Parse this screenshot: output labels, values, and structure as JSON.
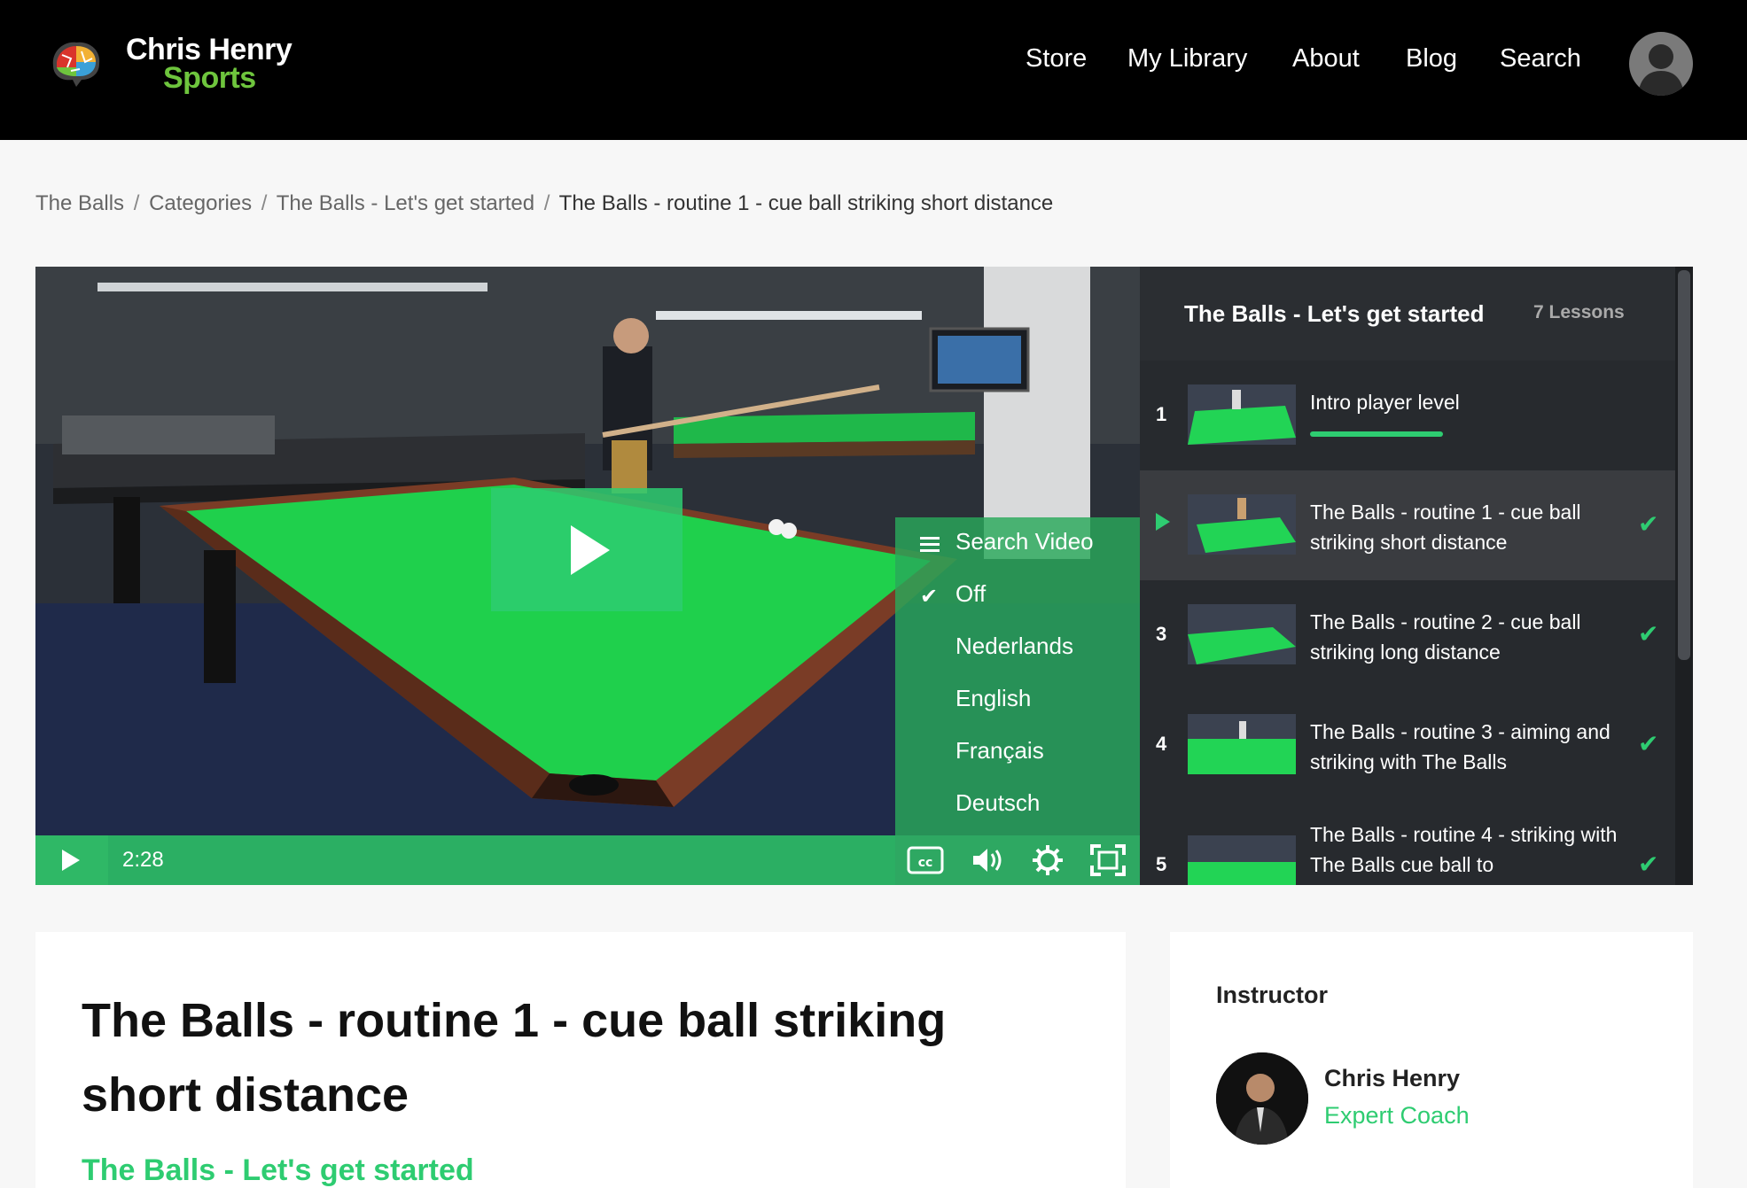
{
  "header": {
    "logo_line1": "Chris Henry",
    "logo_line2": "Sports",
    "nav": [
      "Store",
      "My Library",
      "About",
      "Blog",
      "Search"
    ]
  },
  "breadcrumb": {
    "items": [
      "The Balls",
      "Categories",
      "The Balls - Let's get started"
    ],
    "current": "The Balls - routine 1 - cue ball striking short distance",
    "separator": "/"
  },
  "player": {
    "time": "2:28",
    "captions_menu": {
      "header": "Search Video",
      "options": [
        "Off",
        "Nederlands",
        "English",
        "Français",
        "Deutsch"
      ],
      "selected": "Off"
    },
    "control_icons": [
      "play-icon",
      "closed-captions-icon",
      "volume-icon",
      "settings-icon",
      "fullscreen-icon"
    ]
  },
  "playlist": {
    "title": "The Balls - Let's get started",
    "count": "7 Lessons",
    "lessons": [
      {
        "num": "1",
        "title": "Intro player level",
        "status": "in-progress",
        "progress": 0.6
      },
      {
        "num": "",
        "title": "The Balls - routine 1 - cue ball striking short distance",
        "status": "playing-completed"
      },
      {
        "num": "3",
        "title": "The Balls - routine 2 - cue ball striking long distance",
        "status": "completed"
      },
      {
        "num": "4",
        "title": "The Balls - routine 3 - aiming and striking with The Balls",
        "status": "completed"
      },
      {
        "num": "5",
        "title": "The Balls - routine 4 - striking with The Balls cue ball to",
        "status": "completed"
      }
    ]
  },
  "lesson": {
    "title": "The Balls - routine 1 - cue ball striking short distance",
    "course": "The Balls - Let's get started"
  },
  "instructor": {
    "label": "Instructor",
    "name": "Chris Henry",
    "role": "Expert Coach"
  },
  "colors": {
    "accent": "#2ecc71",
    "header_bg": "#000000",
    "playlist_bg": "#272a2e"
  }
}
